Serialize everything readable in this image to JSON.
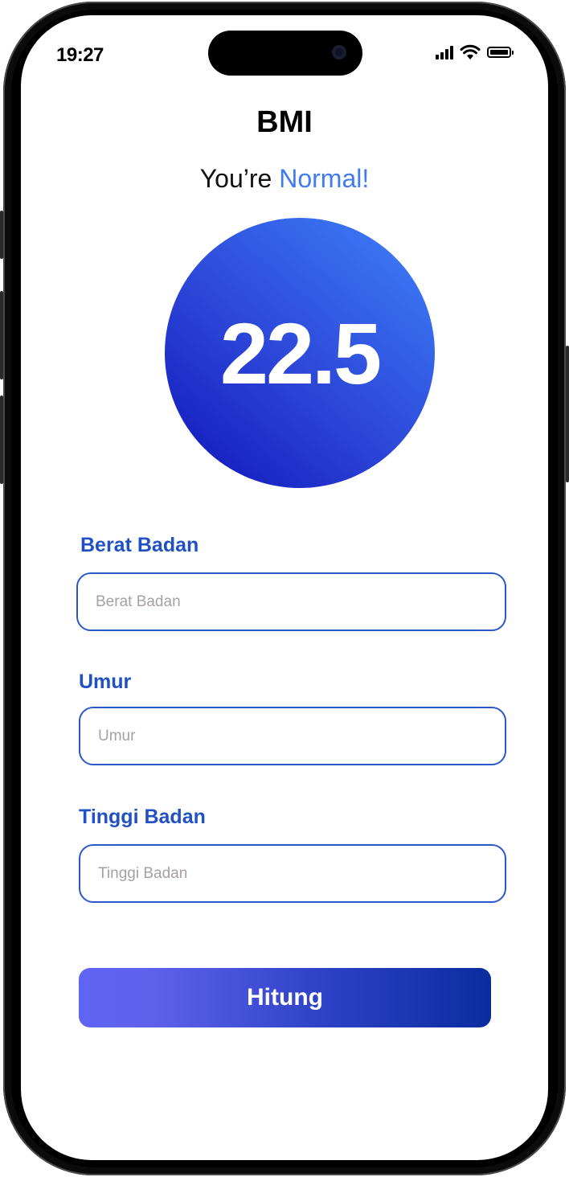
{
  "status_bar": {
    "time": "19:27",
    "icons": [
      "signal-icon",
      "wifi-icon",
      "battery-icon"
    ]
  },
  "header": {
    "title": "BMI",
    "result_prefix": "You’re ",
    "result_category": "Normal!"
  },
  "result": {
    "bmi_value": "22.5"
  },
  "form": {
    "berat_badan": {
      "label": "Berat Badan",
      "placeholder": "Berat Badan",
      "value": ""
    },
    "umur": {
      "label": "Umur",
      "placeholder": "Umur",
      "value": ""
    },
    "tinggi_badan": {
      "label": "Tinggi Badan",
      "placeholder": "Tinggi Badan",
      "value": ""
    }
  },
  "actions": {
    "submit_label": "Hitung"
  },
  "colors": {
    "accent": "#3f7bf2",
    "label_blue": "#2150c4",
    "input_border": "#2a58c6",
    "circle_start": "#1014b8",
    "circle_end": "#3f82fb",
    "button_start": "#5f65f3",
    "button_end": "#0a2d9e"
  }
}
